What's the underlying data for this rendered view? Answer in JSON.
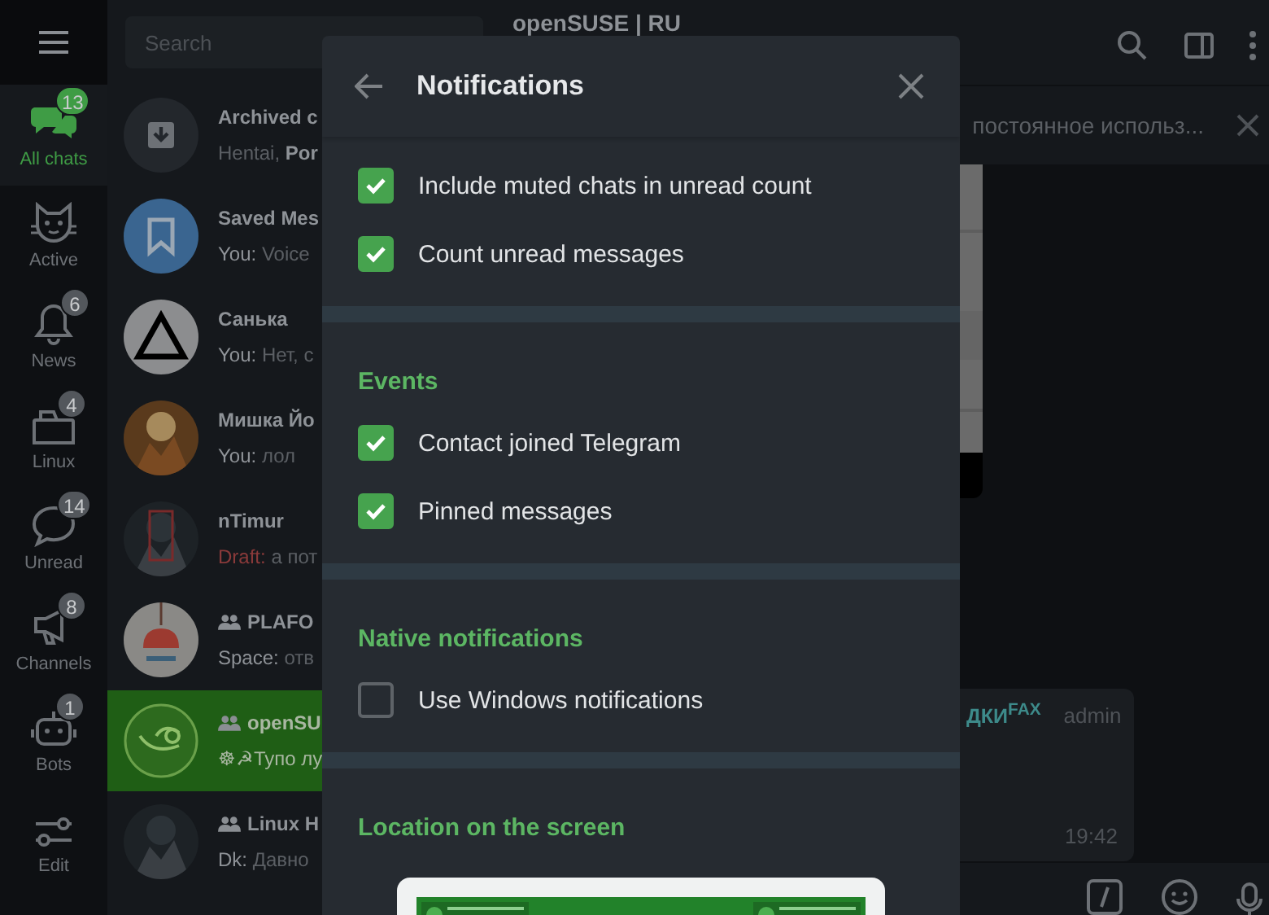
{
  "rail": {
    "items": [
      {
        "label": "All chats",
        "badge": "13",
        "selected": true
      },
      {
        "label": "Active",
        "selected": false
      },
      {
        "label": "News",
        "badge": "6",
        "selected": false
      },
      {
        "label": "Linux",
        "badge": "4",
        "selected": false
      },
      {
        "label": "Unread",
        "badge": "14",
        "selected": false
      },
      {
        "label": "Channels",
        "badge": "8",
        "selected": false
      },
      {
        "label": "Bots",
        "badge": "1",
        "selected": false
      },
      {
        "label": "Edit",
        "selected": false
      }
    ]
  },
  "search": {
    "placeholder": "Search"
  },
  "chats": [
    {
      "name": "Archived c",
      "preview": "Hentai, **Por**",
      "group": false,
      "selected": false
    },
    {
      "name": "Saved Mes",
      "prefix": "You:",
      "draft": false,
      "preview": " Voice",
      "group": false,
      "selected": false
    },
    {
      "name": "Санька",
      "prefix": "You:",
      "draft": false,
      "preview": " Нет, с",
      "group": false,
      "selected": false
    },
    {
      "name": "Мишка Йо",
      "prefix": "You:",
      "draft": false,
      "preview": " лол",
      "group": false,
      "selected": false
    },
    {
      "name": "nTimur",
      "prefix": "Draft:",
      "draft": true,
      "preview": " а пот",
      "group": false,
      "selected": false
    },
    {
      "name": "PLAFO",
      "prefix": "Space:",
      "draft": false,
      "preview": " отв",
      "group": true,
      "selected": false
    },
    {
      "name": "openSU",
      "preview": "☸☭Тупо лу",
      "group": true,
      "selected": true
    },
    {
      "name": "Linux H",
      "prefix": "Dk:",
      "draft": false,
      "preview": " Давно",
      "group": true,
      "selected": false
    }
  ],
  "chat": {
    "title": "openSUSE | RU",
    "pinned": "постоянное использ...",
    "message": {
      "author": "ДКИ$^{FAX}$",
      "role": "admin",
      "time": "19:42"
    }
  },
  "dialog": {
    "title": "Notifications",
    "sections": [
      {
        "rows": [
          {
            "label": "Include muted chats in unread count",
            "checked": true
          },
          {
            "label": "Count unread messages",
            "checked": true
          }
        ]
      },
      {
        "title": "Events",
        "rows": [
          {
            "label": "Contact joined Telegram",
            "checked": true
          },
          {
            "label": "Pinned messages",
            "checked": true
          }
        ]
      },
      {
        "title": "Native notifications",
        "rows": [
          {
            "label": "Use Windows notifications",
            "checked": false
          }
        ]
      },
      {
        "title": "Location on the screen",
        "kind": "location"
      }
    ]
  }
}
